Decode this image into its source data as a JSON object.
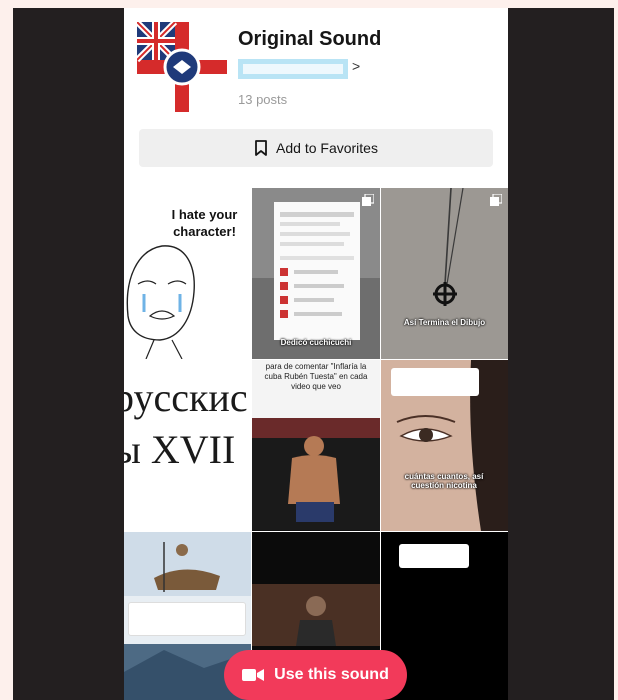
{
  "sound": {
    "title": "Original Sound",
    "posts": "13 posts",
    "author_chevron": ">"
  },
  "favorites": {
    "label": "Add to Favorites"
  },
  "grid": {
    "meme_text": "I hate your character!",
    "cyrillic_line1": "русскис",
    "cyrillic_line2": "ы XVII",
    "video2_caption": "Dedicó cuchicuchi",
    "video3_caption": "Así Termina el Dibujo",
    "video5_caption": "para de comentar \"Inflaría la cuba Rubén Tuesta\" en cada video que veo",
    "video6_caption": "cuántas cuantos, así cuestión nicotina"
  },
  "cta": {
    "label": "Use this sound"
  },
  "colors": {
    "accent": "#f23a5a",
    "frame": "#231f20",
    "page_bg": "#fdf0ec",
    "author_highlight": "#b9e4f5"
  },
  "icons": {
    "favorite": "bookmark-icon",
    "cta": "video-camera-icon",
    "multi": "multi-photo-icon"
  }
}
